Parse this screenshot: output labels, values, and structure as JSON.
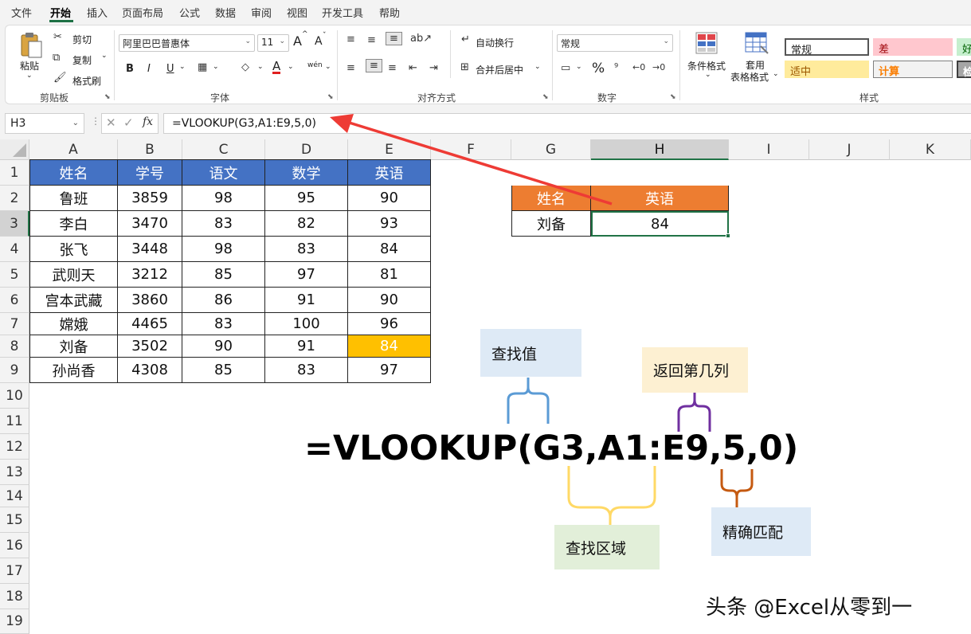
{
  "menu": {
    "items": [
      "文件",
      "开始",
      "插入",
      "页面布局",
      "公式",
      "数据",
      "审阅",
      "视图",
      "开发工具",
      "帮助"
    ],
    "active": "开始"
  },
  "ribbon": {
    "clipboard": {
      "paste": "粘贴",
      "cut": "剪切",
      "copy": "复制",
      "format_painter": "格式刷",
      "group": "剪贴板"
    },
    "font": {
      "font_name": "阿里巴巴普惠体",
      "font_size": "11",
      "bold": "B",
      "italic": "I",
      "underline": "U",
      "grow": "A",
      "shrink": "A",
      "font_color": "A",
      "phonetic": "wén",
      "group": "字体"
    },
    "alignment": {
      "wrap": "自动换行",
      "merge": "合并后居中",
      "group": "对齐方式"
    },
    "number": {
      "format": "常规",
      "percent": "%",
      "group": "数字"
    },
    "styles": {
      "cond_format": "条件格式",
      "table_line1": "套用",
      "table_line2": "表格格式",
      "normal": "常规",
      "bad": "差",
      "good": "好",
      "neutral": "适中",
      "calculation": "计算",
      "check": "检",
      "group": "样式"
    }
  },
  "formula_bar": {
    "name_box": "H3",
    "fx": "fx",
    "formula": "=VLOOKUP(G3,A1:E9,5,0)"
  },
  "columns": [
    "A",
    "B",
    "C",
    "D",
    "E",
    "F",
    "G",
    "H",
    "I",
    "J",
    "K"
  ],
  "rows": [
    "1",
    "2",
    "3",
    "4",
    "5",
    "6",
    "7",
    "8",
    "9",
    "10",
    "11",
    "12",
    "13",
    "14",
    "15",
    "16",
    "17",
    "18",
    "19"
  ],
  "table": {
    "headers": [
      "姓名",
      "学号",
      "语文",
      "数学",
      "英语"
    ],
    "rows": [
      [
        "鲁班",
        "3859",
        "98",
        "95",
        "90"
      ],
      [
        "李白",
        "3470",
        "83",
        "82",
        "93"
      ],
      [
        "张飞",
        "3448",
        "98",
        "83",
        "84"
      ],
      [
        "武则天",
        "3212",
        "85",
        "97",
        "81"
      ],
      [
        "宫本武藏",
        "3860",
        "86",
        "91",
        "90"
      ],
      [
        "嫦娥",
        "4465",
        "83",
        "100",
        "96"
      ],
      [
        "刘备",
        "3502",
        "90",
        "91",
        "84"
      ],
      [
        "孙尚香",
        "4308",
        "85",
        "83",
        "97"
      ]
    ]
  },
  "lookup": {
    "header_name": "姓名",
    "header_value": "英语",
    "name": "刘备",
    "result": "84"
  },
  "annotations": {
    "lookup_value": "查找值",
    "col_index": "返回第几列",
    "lookup_range": "查找区域",
    "exact_match": "精确匹配",
    "formula": "=VLOOKUP(G3,A1:E9,5,0)"
  },
  "watermark": "头条 @Excel从零到一",
  "colors": {
    "table_header": "#4472c4",
    "lookup_header": "#ed7d31",
    "highlight": "#ffc000",
    "arrow": "#ee3b35",
    "excel_green": "#217346"
  }
}
